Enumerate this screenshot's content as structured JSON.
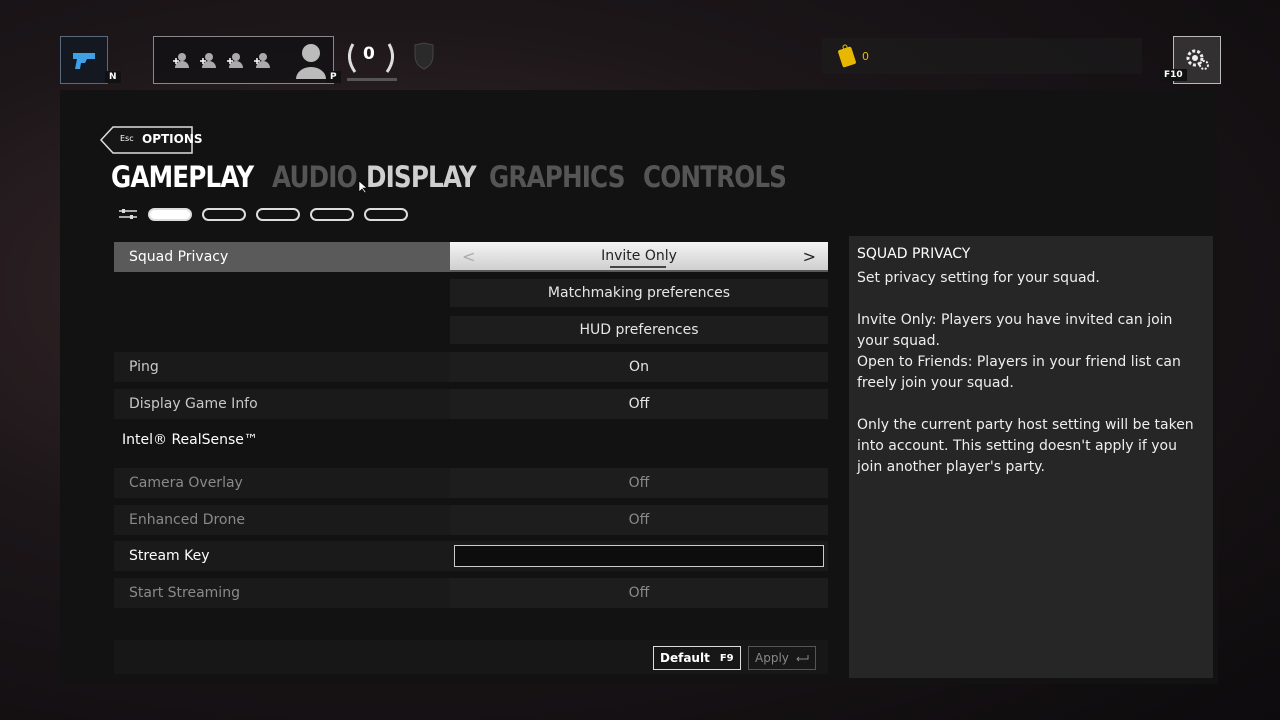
{
  "topbar": {
    "weapon_key": "N",
    "squad_key": "P",
    "rank_value": "0",
    "renown_value": "0",
    "settings_key": "F10"
  },
  "header": {
    "back_key": "Esc",
    "back_label": "OPTIONS"
  },
  "tabs": [
    {
      "label": "GAMEPLAY",
      "state": "active"
    },
    {
      "label": "AUDIO",
      "state": "inactive"
    },
    {
      "label": "DISPLAY",
      "state": "hover"
    },
    {
      "label": "GRAPHICS",
      "state": "inactive"
    },
    {
      "label": "CONTROLS",
      "state": "inactive"
    }
  ],
  "settings": {
    "squad_privacy": {
      "label": "Squad Privacy",
      "value": "Invite Only"
    },
    "matchmaking": {
      "value": "Matchmaking preferences"
    },
    "hud": {
      "value": "HUD preferences"
    },
    "ping": {
      "label": "Ping",
      "value": "On"
    },
    "display_game_info": {
      "label": "Display Game Info",
      "value": "Off"
    },
    "realsense_section": "Intel® RealSense™",
    "camera_overlay": {
      "label": "Camera Overlay",
      "value": "Off"
    },
    "enhanced_drone": {
      "label": "Enhanced Drone",
      "value": "Off"
    },
    "stream_key": {
      "label": "Stream Key",
      "value": ""
    },
    "start_streaming": {
      "label": "Start Streaming",
      "value": "Off"
    }
  },
  "footer": {
    "default_label": "Default",
    "default_key": "F9",
    "apply_label": "Apply"
  },
  "info": {
    "title": "SQUAD PRIVACY",
    "body": "Set privacy setting for your squad.\n\nInvite Only: Players you have invited can join your squad.\nOpen to Friends: Players in your friend list can freely join your squad.\n\nOnly the current party host setting will be taken into account. This setting doesn't apply if you join another player's party."
  },
  "colors": {
    "weapon_icon": "#3fa0e6",
    "renown_icon": "#e8b800"
  }
}
